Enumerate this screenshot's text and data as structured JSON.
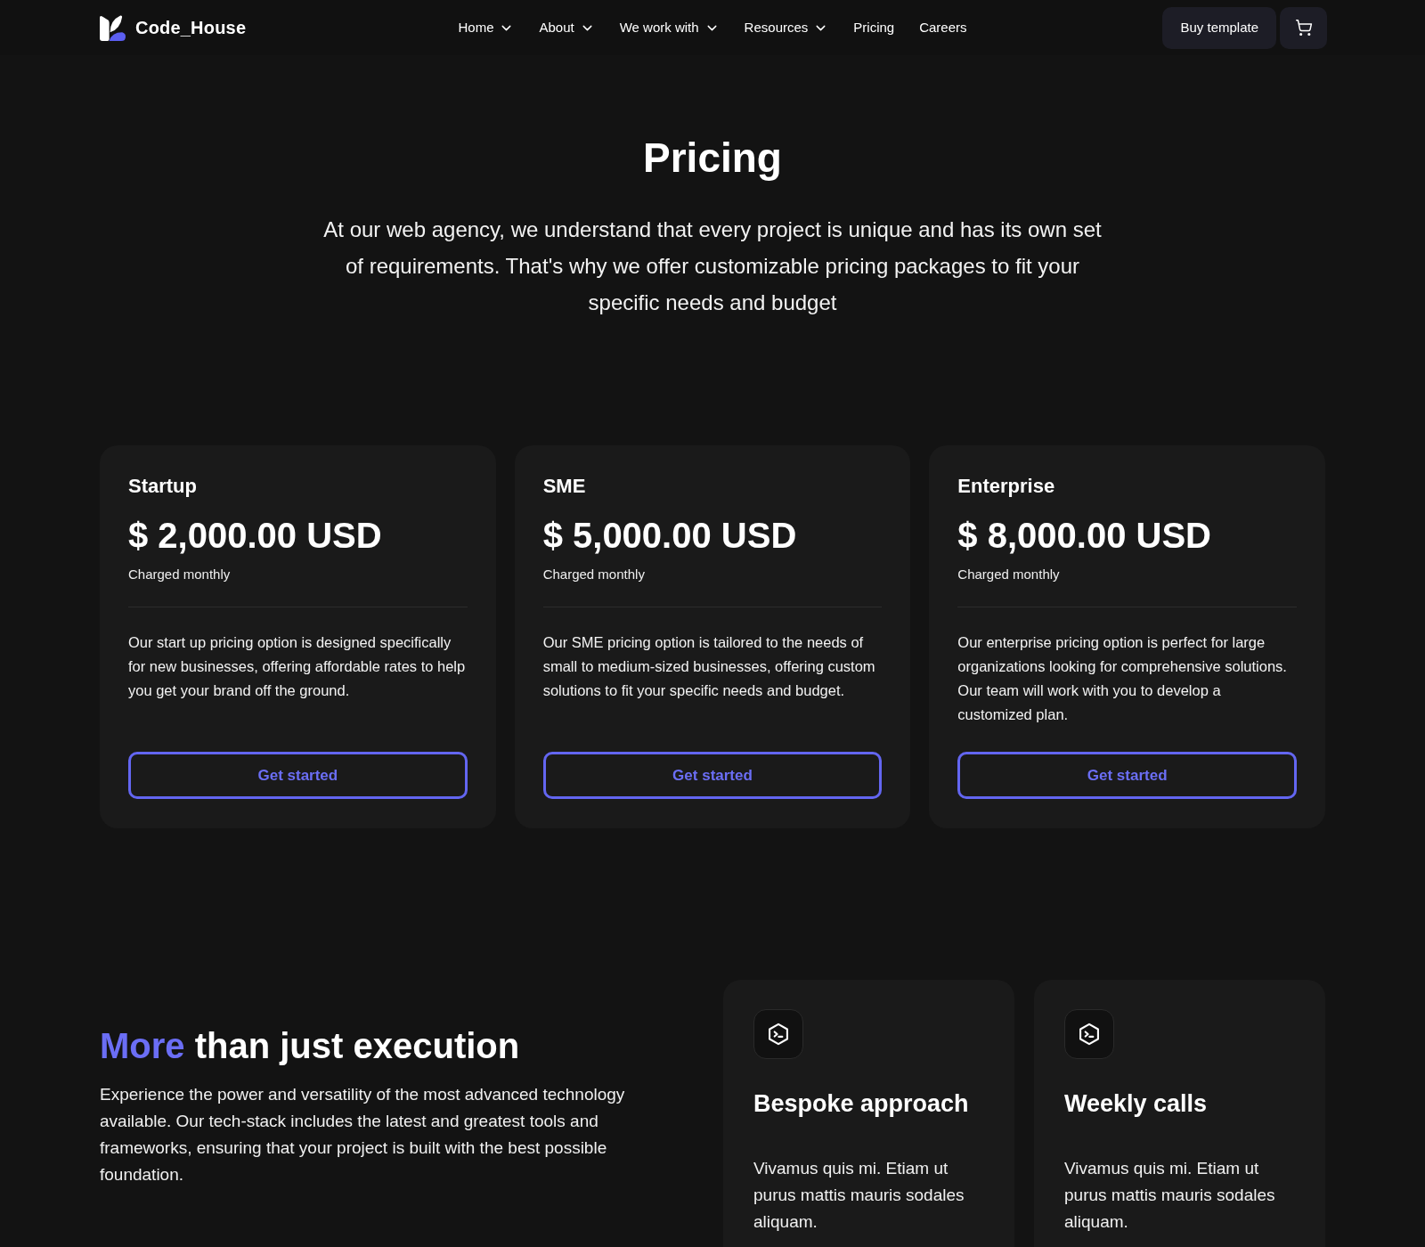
{
  "nav": {
    "brand": "Code_House",
    "links": [
      {
        "label": "Home",
        "dropdown": true
      },
      {
        "label": "About",
        "dropdown": true
      },
      {
        "label": "We work with",
        "dropdown": true
      },
      {
        "label": "Resources",
        "dropdown": true
      },
      {
        "label": "Pricing",
        "dropdown": false
      },
      {
        "label": "Careers",
        "dropdown": false
      }
    ],
    "buy_button": "Buy template"
  },
  "hero": {
    "title": "Pricing",
    "intro": "At our web agency, we understand that every project is unique and has its own set of requirements. That's why we offer customizable pricing packages to fit your specific needs and budget"
  },
  "plans": [
    {
      "name": "Startup",
      "price": "$ 2,000.00 USD",
      "billing": "Charged monthly",
      "description": "Our start up pricing option is designed specifically for new businesses, offering affordable rates to help you get your brand off the ground.",
      "button": "Get started"
    },
    {
      "name": "SME",
      "price": "$ 5,000.00 USD",
      "billing": "Charged monthly",
      "description": "Our SME pricing option is tailored to the needs of small to medium-sized businesses, offering custom solutions to fit your specific needs and budget.",
      "button": "Get started"
    },
    {
      "name": "Enterprise",
      "price": "$ 8,000.00 USD",
      "billing": "Charged monthly",
      "description": "Our enterprise pricing option is perfect for large organizations looking for comprehensive solutions. Our team will work with you to develop a customized plan.",
      "button": "Get started"
    }
  ],
  "features": {
    "heading_accent": "More",
    "heading_rest": "than just execution",
    "body": "Experience the power and versatility of the most advanced technology available. Our tech-stack includes the latest and greatest tools and frameworks, ensuring that your project is built with the best possible foundation.",
    "cards": [
      {
        "title": "Bespoke approach",
        "text": "Vivamus quis mi. Etiam ut purus mattis mauris sodales aliquam."
      },
      {
        "title": "Weekly calls",
        "text": "Vivamus quis mi. Etiam ut purus mattis mauris sodales aliquam."
      }
    ]
  }
}
